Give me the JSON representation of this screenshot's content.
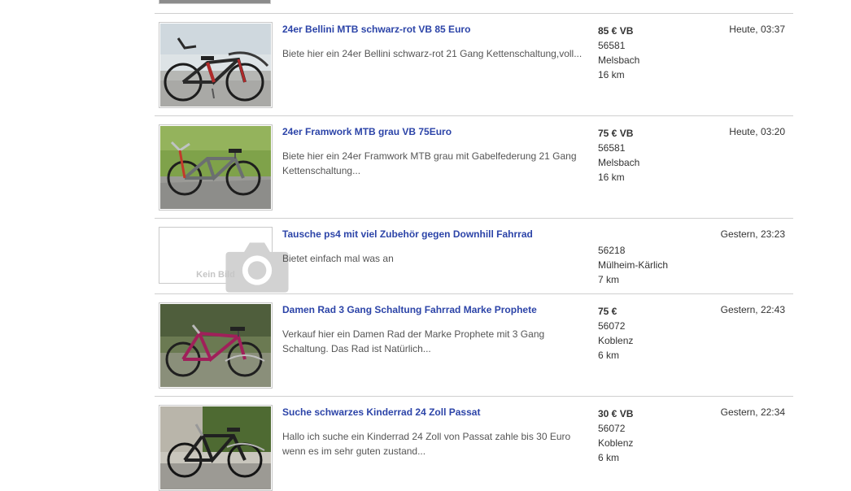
{
  "listings": [
    {
      "title": "24er Bellini MTB schwarz-rot VB 85 Euro",
      "description": "Biete hier ein 24er Bellini schwarz-rot 21 Gang Kettenschaltung,voll...",
      "price": "85 € VB",
      "zip": "56581",
      "city": "Melsbach",
      "distance": "16 km",
      "date": "Heute, 03:37"
    },
    {
      "title": "24er Framwork MTB grau VB 75Euro",
      "description": "Biete hier ein 24er Framwork MTB grau mit Gabelfederung 21 Gang Kettenschaltung...",
      "price": "75 € VB",
      "zip": "56581",
      "city": "Melsbach",
      "distance": "16 km",
      "date": "Heute, 03:20"
    },
    {
      "title": "Tausche ps4 mit viel Zubehör gegen Downhill Fahrrad",
      "description": "Bietet einfach mal was an",
      "price": "",
      "zip": "56218",
      "city": "Mülheim-Kärlich",
      "distance": "7 km",
      "date": "Gestern, 23:23",
      "no_image_label": "Kein Bild"
    },
    {
      "title": "Damen Rad 3 Gang Schaltung Fahrrad Marke Prophete",
      "description": "Verkauf hier ein Damen Rad der Marke Prophete mit 3 Gang Schaltung. Das Rad ist Natürlich...",
      "price": "75 €",
      "zip": "56072",
      "city": "Koblenz",
      "distance": "6 km",
      "date": "Gestern, 22:43"
    },
    {
      "title": "Suche schwarzes Kinderrad 24 Zoll Passat",
      "description": "Hallo ich suche ein Kinderrad 24 Zoll von Passat zahle bis 30 Euro wenn es im sehr guten zustand...",
      "price": "30 € VB",
      "zip": "56072",
      "city": "Koblenz",
      "distance": "6 km",
      "date": "Gestern, 22:34"
    }
  ],
  "colors": {
    "link": "#2c44a8",
    "divider": "#cfcfcf",
    "text": "#333333",
    "muted_text": "#555555",
    "placeholder_text": "#c6c6c6"
  },
  "icons": {
    "no_image": "camera-icon"
  }
}
